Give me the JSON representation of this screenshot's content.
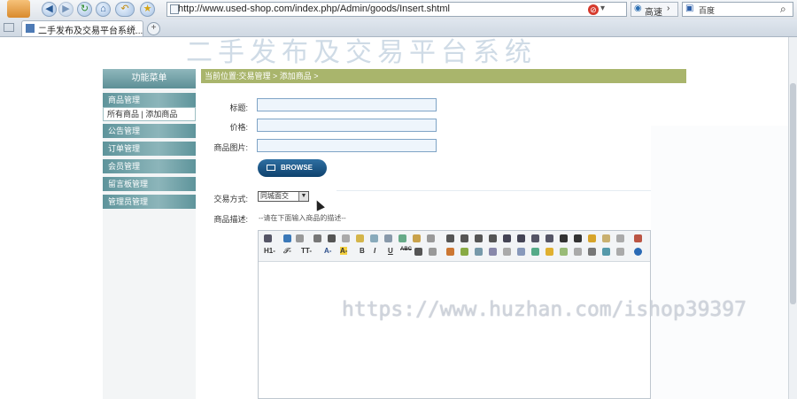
{
  "browser": {
    "url": "http://www.used-shop.com/index.php/Admin/goods/Insert.shtml",
    "compat_label": "高速",
    "search_placeholder": "百度",
    "tab_title": "二手发布及交易平台系统...",
    "tab_close": "×",
    "new_tab": "+"
  },
  "page": {
    "background_title": "二手发布及交易平台系统",
    "sidebar": {
      "header": "功能菜单",
      "items": [
        {
          "label": "商品管理"
        },
        {
          "label": "公告管理"
        },
        {
          "label": "订单管理"
        },
        {
          "label": "会员管理"
        },
        {
          "label": "留言板管理"
        },
        {
          "label": "管理员管理"
        }
      ],
      "sub_links": "所有商品 | 添加商品"
    },
    "breadcrumb": "当前位置:交易管理 > 添加商品 >",
    "form": {
      "title_label": "标题:",
      "price_label": "价格:",
      "image_label": "商品图片:",
      "browse_label": "BROWSE",
      "trade_label": "交易方式:",
      "trade_value": "同城面交",
      "desc_label": "商品描述:",
      "desc_hint": "--请在下面输入商品的描述--"
    },
    "editor_toolbar_row2": [
      "H1-",
      "𝒯-",
      "TT-",
      "A-",
      "A-",
      "B",
      "I",
      "U",
      "ABC"
    ],
    "watermark": "https://www.huzhan.com/ishop39397"
  },
  "colors": {
    "sidebar": "#6a9ca3",
    "breadcrumb": "#a9b56c",
    "browse_button": "#1e5a8a",
    "input_border": "#7fa4c6"
  }
}
